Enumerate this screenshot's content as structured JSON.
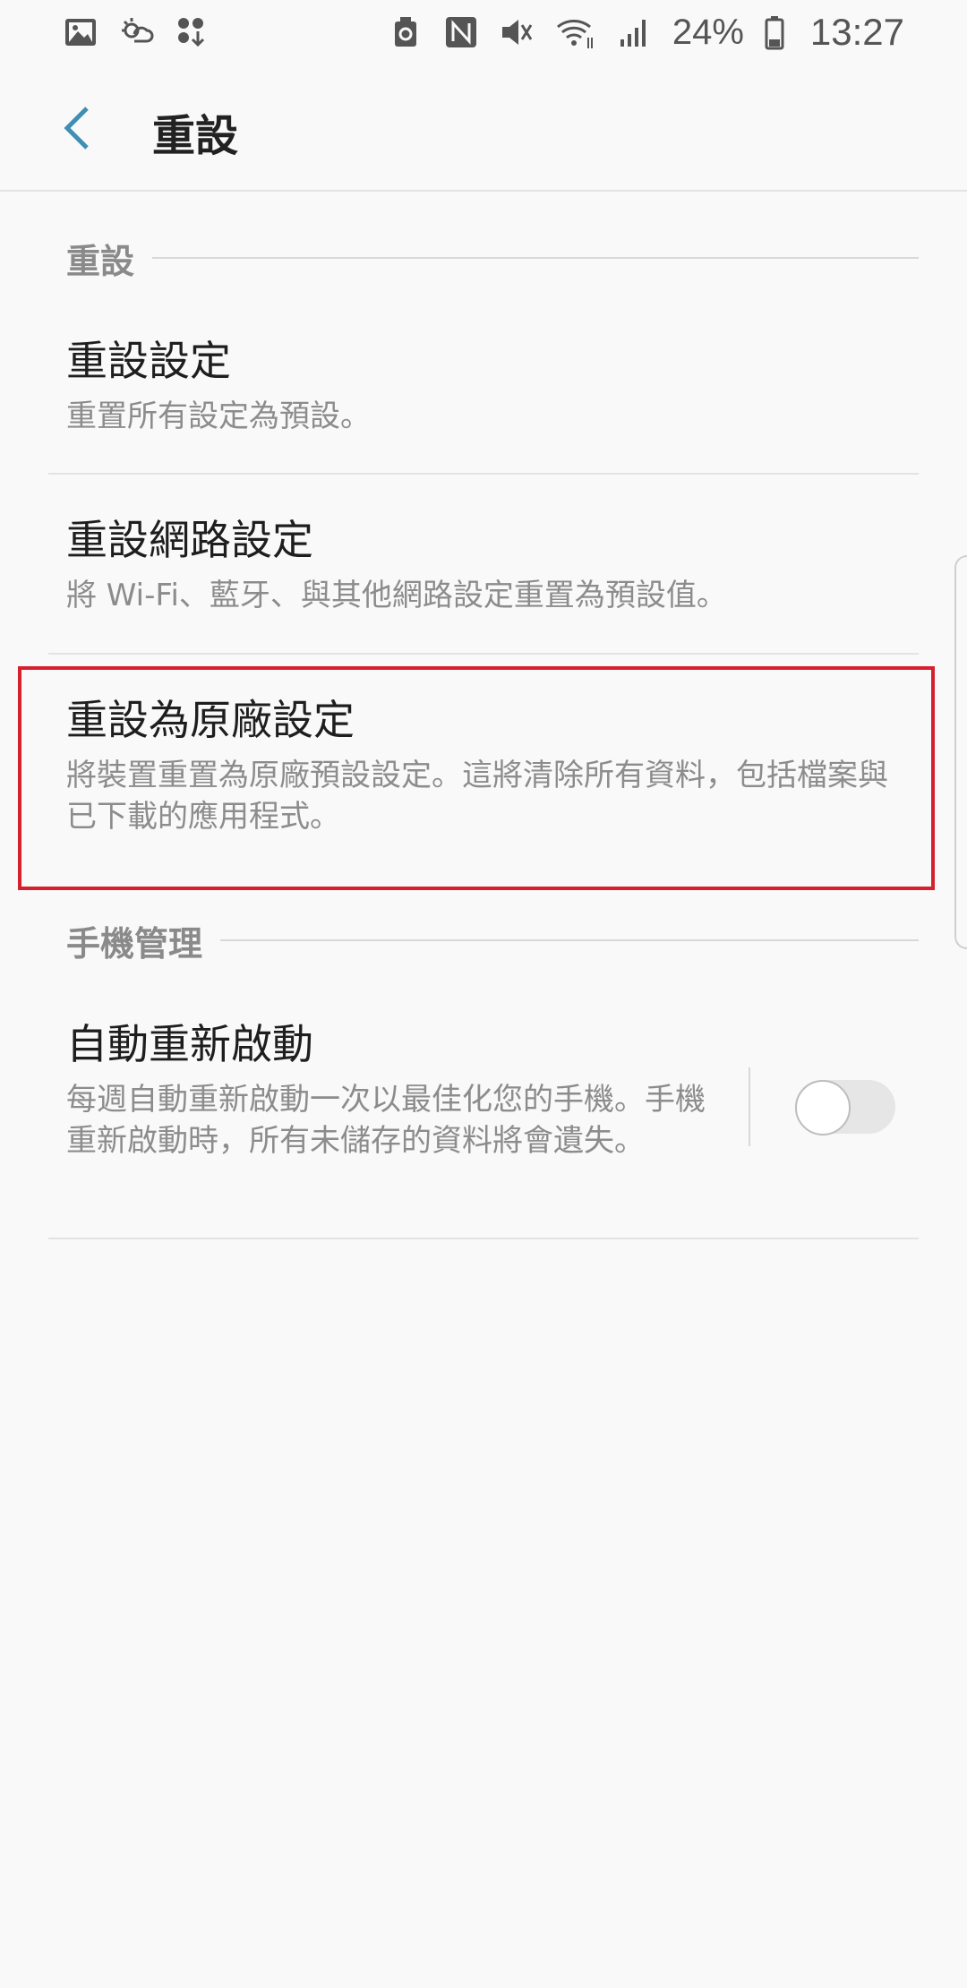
{
  "status_bar": {
    "icons_left": [
      "gallery-icon",
      "weather-icon",
      "download-icon"
    ],
    "icons_right": [
      "recycle-icon",
      "nfc-icon",
      "mute-icon",
      "wifi-icon",
      "signal-icon"
    ],
    "battery": "24%",
    "time": "13:27"
  },
  "header": {
    "title": "重設"
  },
  "sections": {
    "reset": {
      "label": "重設",
      "items": [
        {
          "title": "重設設定",
          "summary": "重置所有設定為預設。"
        },
        {
          "title": "重設網路設定",
          "summary": "將 Wi-Fi、藍牙、與其他網路設定重置為預設值。"
        },
        {
          "title": "重設為原廠設定",
          "summary": "將裝置重置為原廠預設設定。這將清除所有資料，包括檔案與已下載的應用程式。"
        }
      ]
    },
    "device_care": {
      "label": "手機管理",
      "items": [
        {
          "title": "自動重新啟動",
          "summary": "每週自動重新啟動一次以最佳化您的手機。手機重新啟動時，所有未儲存的資料將會遺失。",
          "toggle_on": false
        }
      ]
    }
  },
  "colors": {
    "accent": "#3f8fb5",
    "highlight": "#d7202e"
  }
}
